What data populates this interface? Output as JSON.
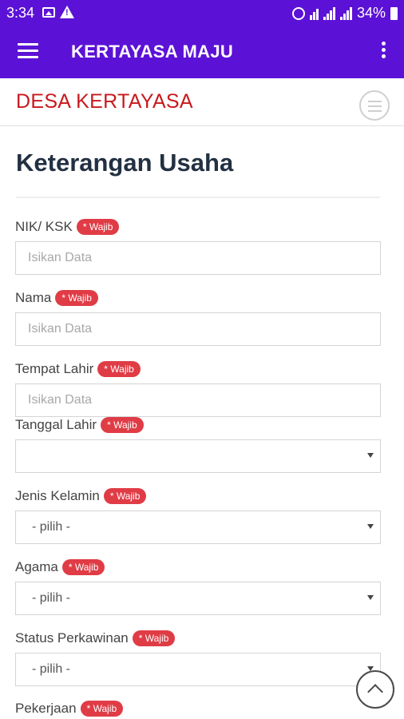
{
  "status_bar": {
    "time": "3:34",
    "battery_text": "34%",
    "left_icons": [
      "image-icon",
      "warning-icon"
    ],
    "right_icons": [
      "alarm-icon",
      "wifi-icon",
      "signal-icon",
      "signal-icon",
      "battery-icon"
    ]
  },
  "app_bar": {
    "title": "KERTAYASA MAJU",
    "menu_icon": "hamburger-icon",
    "overflow_icon": "more-vert-icon",
    "color": "#5c12d6"
  },
  "sub_header": {
    "brand": "DESA KERTAYASA",
    "brand_color": "#c8191d",
    "menu_icon": "circle-menu-icon"
  },
  "page": {
    "title": "Keterangan Usaha"
  },
  "form": {
    "required_badge": "* Wajib",
    "fields": [
      {
        "label": "NIK/ KSK",
        "type": "text",
        "placeholder": "Isikan Data",
        "value": ""
      },
      {
        "label": "Nama",
        "type": "text",
        "placeholder": "Isikan Data",
        "value": ""
      },
      {
        "label": "Tempat Lahir",
        "type": "text",
        "placeholder": "Isikan Data",
        "value": ""
      },
      {
        "label": "Tanggal Lahir",
        "type": "select",
        "value": ""
      },
      {
        "label": "Jenis Kelamin",
        "type": "select",
        "value": "- pilih -"
      },
      {
        "label": "Agama",
        "type": "select",
        "value": "- pilih -"
      },
      {
        "label": "Status Perkawinan",
        "type": "select",
        "value": "- pilih -"
      },
      {
        "label": "Pekerjaan",
        "type": "select",
        "value": ""
      }
    ]
  },
  "scroll_top_icon": "chevron-up-icon",
  "badge_color": "#e03c46"
}
